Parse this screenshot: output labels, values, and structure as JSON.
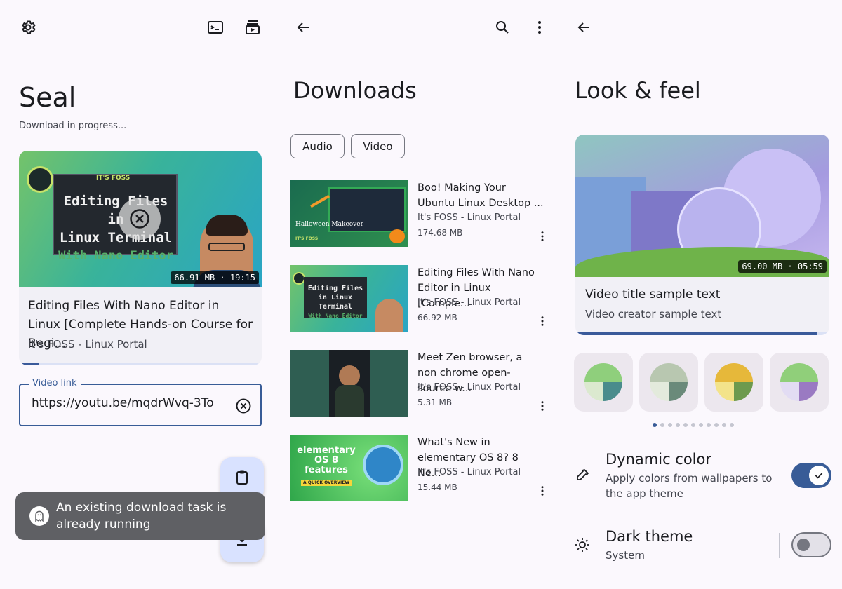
{
  "home": {
    "title": "Seal",
    "subtitle": "Download in progress...",
    "video_card": {
      "thumb_badge": "IT'S FOSS",
      "thumb_line1": "Editing Files in",
      "thumb_line2": "Linux Terminal",
      "thumb_line3": "With Nano Editor",
      "duration": "66.91 MB · 19:15",
      "title": "Editing Files With Nano Editor in Linux [Complete Hands-on Course for Begi...",
      "author": "It's FOSS - Linux Portal",
      "progress": 0.08
    },
    "video_link": {
      "label": "Video link",
      "value": "https://youtu.be/mqdrWvq-3To"
    },
    "snackbar": "An existing download task is already running"
  },
  "downloads": {
    "title": "Downloads",
    "chips": [
      "Audio",
      "Video"
    ],
    "items": [
      {
        "title": "Boo! Making Your Ubuntu Linux Desktop ...",
        "author": "It's FOSS - Linux Portal",
        "size": "174.68 MB",
        "thumb_text": "Halloween Makeover",
        "thumb_badge": "IT'S FOSS"
      },
      {
        "title": "Editing Files With Nano Editor in Linux [Comple...",
        "author": "It's FOSS - Linux Portal",
        "size": "66.92 MB",
        "thumb_text": "Editing Files in Linux Terminal",
        "thumb_badge": "With Nano Editor"
      },
      {
        "title": "Meet Zen browser, a non chrome open-source w...",
        "author": "It's FOSS - Linux Portal",
        "size": "5.31 MB",
        "thumb_text": "",
        "thumb_badge": ""
      },
      {
        "title": "What's New in elementary OS 8? 8 Ne...",
        "author": "It's FOSS - Linux Portal",
        "size": "15.44 MB",
        "thumb_text": "elementary OS 8 features",
        "thumb_badge": "A QUICK OVERVIEW"
      }
    ]
  },
  "look_feel": {
    "title": "Look & feel",
    "preview": {
      "duration": "69.00 MB · 05:59",
      "title": "Video title sample text",
      "creator": "Video creator sample text",
      "progress": 0.95
    },
    "swatches": [
      {
        "c1": "#8fcf7c",
        "c2": "#dbe9cf",
        "c3": "#4a8c8c"
      },
      {
        "c1": "#b8c7b0",
        "c2": "#e3eadc",
        "c3": "#6a8a7a"
      },
      {
        "c1": "#e6b83a",
        "c2": "#f3e38a",
        "c3": "#6d9a4e"
      },
      {
        "c1": "#90cf7a",
        "c2": "#e2dcf3",
        "c3": "#9a7ac2"
      }
    ],
    "pager_count": 11,
    "dynamic_color": {
      "title": "Dynamic color",
      "desc": "Apply colors from wallpapers to the app theme",
      "enabled": true
    },
    "dark_theme": {
      "title": "Dark theme",
      "desc": "System",
      "enabled": false
    }
  },
  "colors": {
    "primary": "#385c97",
    "surface": "#fbf8fd"
  }
}
